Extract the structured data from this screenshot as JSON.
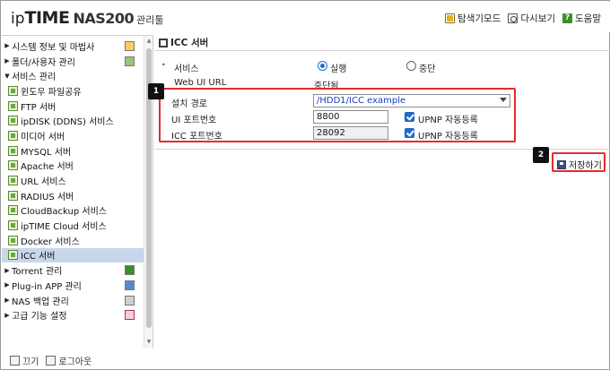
{
  "header": {
    "logo_ip": "ip",
    "logo_time": "TIME",
    "logo_model": "NAS200",
    "logo_tool": "관리툴",
    "nav": [
      {
        "label": "탐색기모드",
        "icon": "explorer-icon"
      },
      {
        "label": "다시보기",
        "icon": "reload-icon"
      },
      {
        "label": "도움말",
        "icon": "help-icon"
      }
    ]
  },
  "sidebar": {
    "top_items": [
      {
        "label": "시스템 정보 및 마법사",
        "expanded": false
      },
      {
        "label": "폴더/사용자 관리",
        "expanded": false
      },
      {
        "label": "서비스 관리",
        "expanded": true
      }
    ],
    "service_items": [
      {
        "label": "윈도우 파일공유"
      },
      {
        "label": "FTP 서버"
      },
      {
        "label": "ipDISK (DDNS) 서비스"
      },
      {
        "label": "미디어 서버"
      },
      {
        "label": "MYSQL 서버"
      },
      {
        "label": "Apache 서버"
      },
      {
        "label": "URL 서비스"
      },
      {
        "label": "RADIUS 서버"
      },
      {
        "label": "CloudBackup 서비스"
      },
      {
        "label": "ipTIME Cloud 서비스"
      },
      {
        "label": "Docker 서비스"
      },
      {
        "label": "ICC 서버",
        "active": true
      }
    ],
    "bottom_items": [
      {
        "label": "Torrent 관리"
      },
      {
        "label": "Plug-in APP 관리"
      },
      {
        "label": "NAS 백업 관리"
      },
      {
        "label": "고급 기능 설정"
      }
    ]
  },
  "footer": {
    "off_label": "끄기",
    "logout_label": "로그아웃"
  },
  "main": {
    "title": "ICC 서버",
    "service_label": "서비스",
    "run_label": "실행",
    "stop_label": "중단",
    "service_state": "실행",
    "webui_label": "Web UI URL",
    "webui_value": "중단됨",
    "install_path_label": "설치 경로",
    "install_path_value": "/HDD1/ICC example",
    "ui_port_label": "UI 포트번호",
    "ui_port_value": "8800",
    "icc_port_label": "ICC 포트번호",
    "icc_port_value": "28092",
    "upnp_label": "UPNP 자동등록",
    "save_label": "저장하기",
    "badge_1": "1",
    "badge_2": "2"
  },
  "colors": {
    "highlight": "#e52b2b",
    "selected_row": "#c8d6ec",
    "checkbox": "#1e6fd0",
    "path_text": "#1a3cc6"
  }
}
